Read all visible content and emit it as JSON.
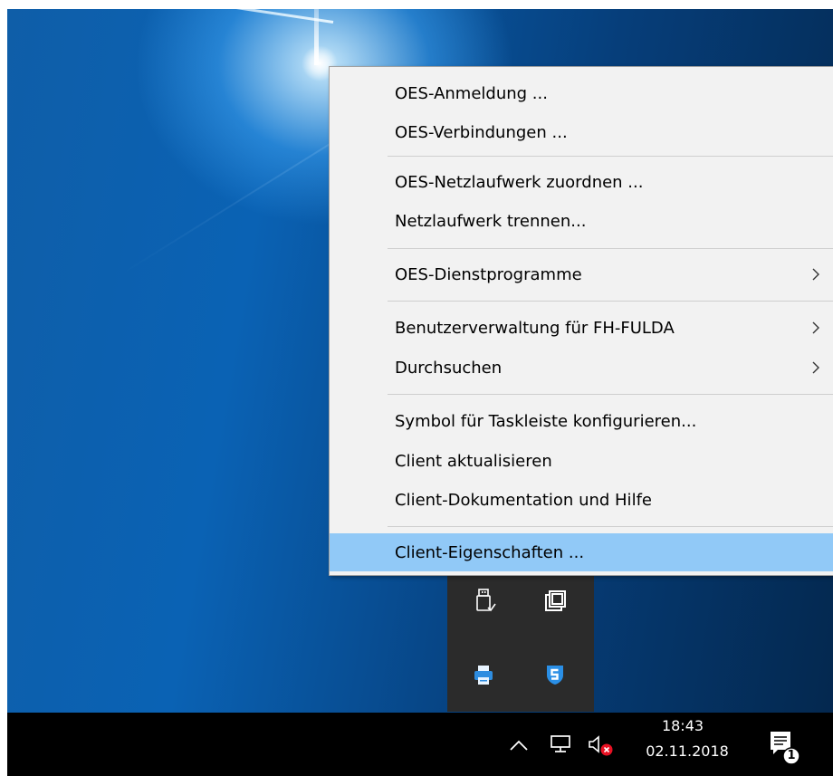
{
  "menu": {
    "items": [
      {
        "label": "OES-Anmeldung ...",
        "has_submenu": false
      },
      {
        "label": "OES-Verbindungen ...",
        "has_submenu": false
      },
      {
        "label": "OES-Netzlaufwerk zuordnen ...",
        "has_submenu": false
      },
      {
        "label": "Netzlaufwerk trennen...",
        "has_submenu": false
      },
      {
        "label": "OES-Dienstprogramme",
        "has_submenu": true
      },
      {
        "label": "Benutzerverwaltung für FH-FULDA",
        "has_submenu": true
      },
      {
        "label": "Durchsuchen",
        "has_submenu": true
      },
      {
        "label": "Symbol für Taskleiste konfigurieren...",
        "has_submenu": false
      },
      {
        "label": "Client aktualisieren",
        "has_submenu": false
      },
      {
        "label": "Client-Dokumentation und Hilfe",
        "has_submenu": false
      },
      {
        "label": "Client-Eigenschaften ...",
        "has_submenu": false,
        "highlighted": true
      }
    ]
  },
  "tray_overflow": {
    "icons": [
      "usb-drive-icon",
      "window-restore-icon",
      "printer-icon",
      "sophos-shield-icon"
    ]
  },
  "taskbar": {
    "tray_icons": [
      "chevron-up-icon",
      "network-icon",
      "speaker-muted-icon"
    ],
    "clock": {
      "time": "18:43",
      "date": "02.11.2018"
    },
    "notification_count": "1"
  },
  "colors": {
    "menu_background": "#f2f2f2",
    "menu_highlight": "#91c9f7",
    "taskbar": "#000000",
    "tray_popup": "#2b2b2b",
    "muted_badge": "#e81123"
  }
}
